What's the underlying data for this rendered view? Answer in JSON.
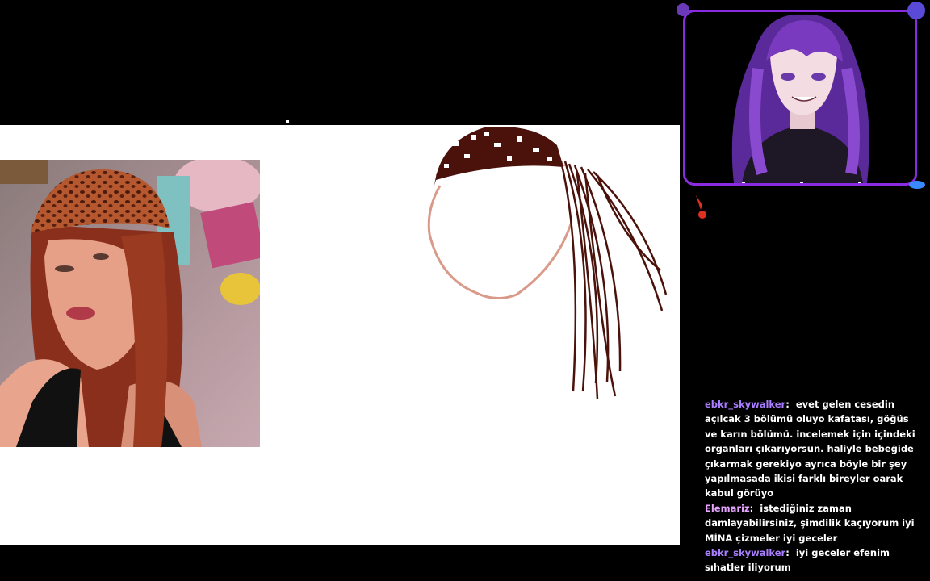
{
  "colors": {
    "background": "#000000",
    "canvas": "#ffffff",
    "frame_border": "#8a2be2",
    "username_color": "#a97dff",
    "username2_color": "#e6a4ff",
    "hair_stroke": "#4a120b",
    "face_stroke": "#d99a8a"
  },
  "icons": {
    "pointer": "red-arrow-cursor"
  },
  "chat": {
    "messages": [
      {
        "user": "ebkr_skywalker",
        "separator": ":",
        "text": "evet gelen cesedin açılcak 3 bölümü oluyo kafatası, göğüs ve karın bölümü. incelemek için içindeki organları çıkarıyorsun. haliyle bebeğide çıkarmak gerekiyo ayrıca böyle bir şey yapılmasada ikisi farklı bireyler oarak kabul görüyo"
      },
      {
        "user": "Elemariz",
        "separator": ":",
        "text": "istediğiniz zaman damlayabilirsiniz, şimdilik kaçıyorum iyi MİNA çizmeler iyi geceler"
      },
      {
        "user": "ebkr_skywalker",
        "separator": ":",
        "text": "iyi geceler efenim sıhatler iliyorum"
      }
    ]
  }
}
